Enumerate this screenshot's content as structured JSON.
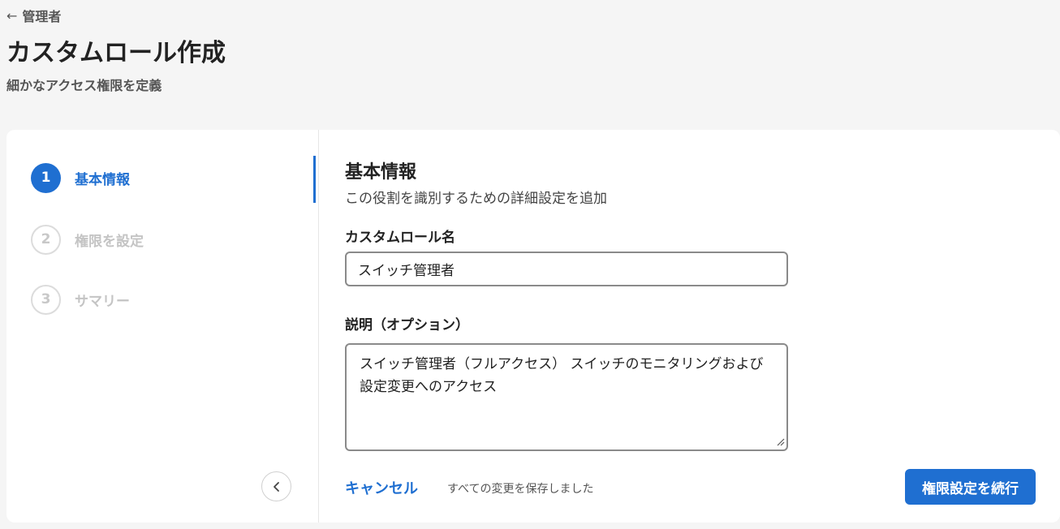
{
  "header": {
    "back_label": "管理者",
    "title": "カスタムロール作成",
    "subtitle": "細かなアクセス権限を定義"
  },
  "stepper": {
    "steps": [
      {
        "number": "1",
        "label": "基本情報",
        "state": "active"
      },
      {
        "number": "2",
        "label": "権限を設定",
        "state": "inactive"
      },
      {
        "number": "3",
        "label": "サマリー",
        "state": "inactive"
      }
    ]
  },
  "form": {
    "section_title": "基本情報",
    "section_desc": "この役割を識別するための詳細設定を追加",
    "name_label": "カスタムロール名",
    "name_value": "スイッチ管理者",
    "desc_label": "説明（オプション）",
    "desc_value": "スイッチ管理者（フルアクセス） スイッチのモニタリングおよび設定変更へのアクセス"
  },
  "footer": {
    "cancel_label": "キャンセル",
    "saved_status": "すべての変更を保存しました",
    "continue_label": "権限設定を続行"
  },
  "colors": {
    "accent": "#1f6fd1",
    "background": "#f5f5f5",
    "card": "#ffffff",
    "inactive_step": "#c4c4c4"
  },
  "icons": {
    "back": "arrow-left-icon",
    "collapse": "chevron-left-icon",
    "resize": "resize-handle-icon"
  }
}
